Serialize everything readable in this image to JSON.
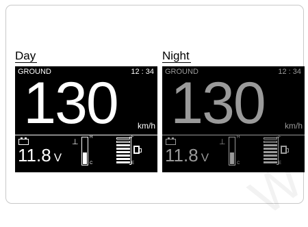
{
  "headings": {
    "day": "Day",
    "night": "Night"
  },
  "colors": {
    "day_text": "#ffffff",
    "night_text": "#9a9a9a",
    "panel_bg": "#000000"
  },
  "day": {
    "mode": "GROUND",
    "clock": "12 : 34",
    "speed": "130",
    "unit": "km/h",
    "voltage": "11.8",
    "voltage_unit": "V",
    "temp_hot": "H",
    "temp_cold": "C",
    "fuel_full": "F",
    "fuel_empty": "E",
    "temp_level": 0.45,
    "fuel_bars_lit": 6,
    "fuel_bars_total": 8
  },
  "night": {
    "mode": "GROUND",
    "clock": "12 : 34",
    "speed": "130",
    "unit": "km/h",
    "voltage": "11.8",
    "voltage_unit": "V",
    "temp_hot": "H",
    "temp_cold": "C",
    "fuel_full": "F",
    "fuel_empty": "E",
    "temp_level": 0.45,
    "fuel_bars_lit": 6,
    "fuel_bars_total": 8
  },
  "watermark": "W"
}
